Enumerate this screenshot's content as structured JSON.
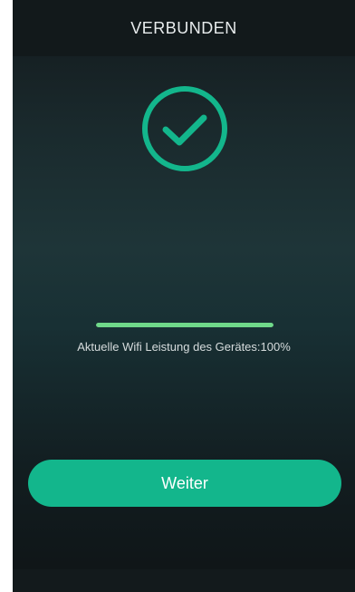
{
  "header": {
    "title": "VERBUNDEN"
  },
  "status": {
    "icon": "check-circle-icon",
    "accent_color": "#13b68c",
    "progress_percent": 100,
    "progress_color": "#6fd98a",
    "wifi_text": "Aktuelle Wifi Leistung des Gerätes:100%"
  },
  "actions": {
    "next_label": "Weiter"
  }
}
